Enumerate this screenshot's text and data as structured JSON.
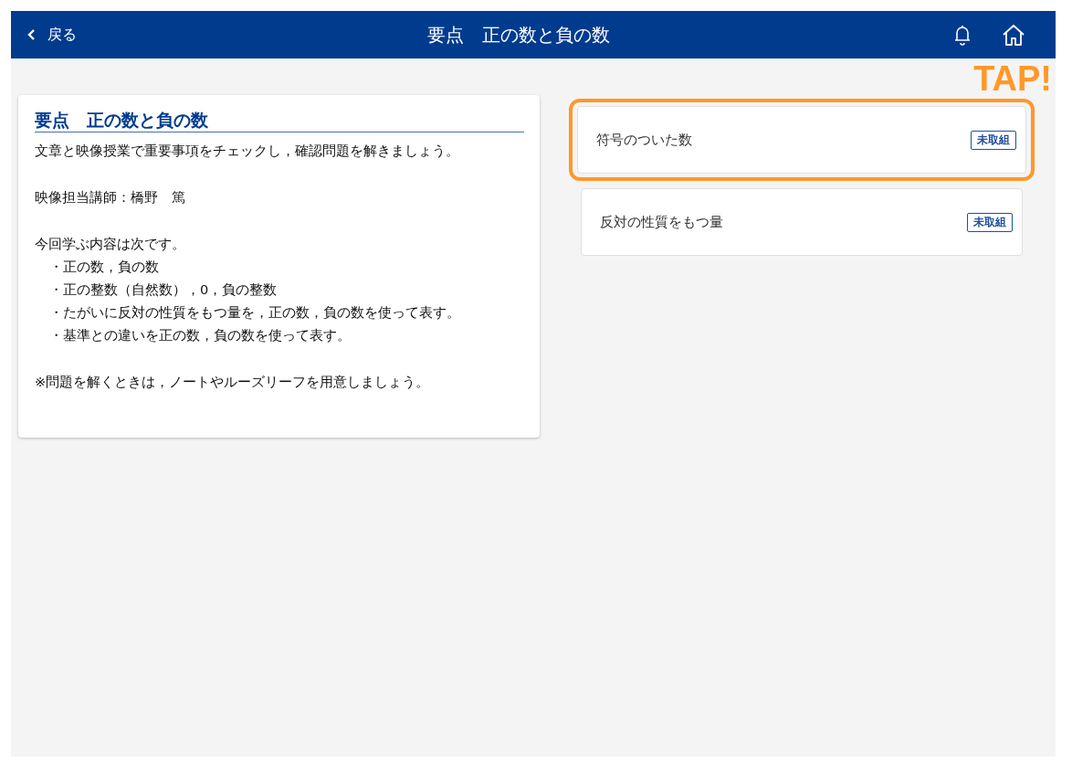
{
  "header": {
    "back": "戻る",
    "title": "要点　正の数と負の数"
  },
  "annotation": "TAP!",
  "summary": {
    "title": "要点　正の数と負の数",
    "paragraphs": [
      {
        "kind": "text",
        "text": "文章と映像授業で重要事項をチェックし，確認問題を解きましょう。"
      },
      {
        "kind": "text",
        "text": "映像担当講師：橋野　篤"
      },
      {
        "kind": "list",
        "text": "今回学ぶ内容は次です。",
        "items": [
          "・正の数，負の数",
          "・正の整数（自然数），0，負の整数",
          "・たがいに反対の性質をもつ量を，正の数，負の数を使って表す。",
          "・基準との違いを正の数，負の数を使って表す。"
        ]
      },
      {
        "kind": "text",
        "text": "※問題を解くときは，ノートやルーズリーフを用意しましょう。"
      }
    ]
  },
  "lessons": [
    {
      "title": "符号のついた数",
      "status": "未取組",
      "highlighted": true
    },
    {
      "title": "反対の性質をもつ量",
      "status": "未取組",
      "highlighted": false
    }
  ]
}
